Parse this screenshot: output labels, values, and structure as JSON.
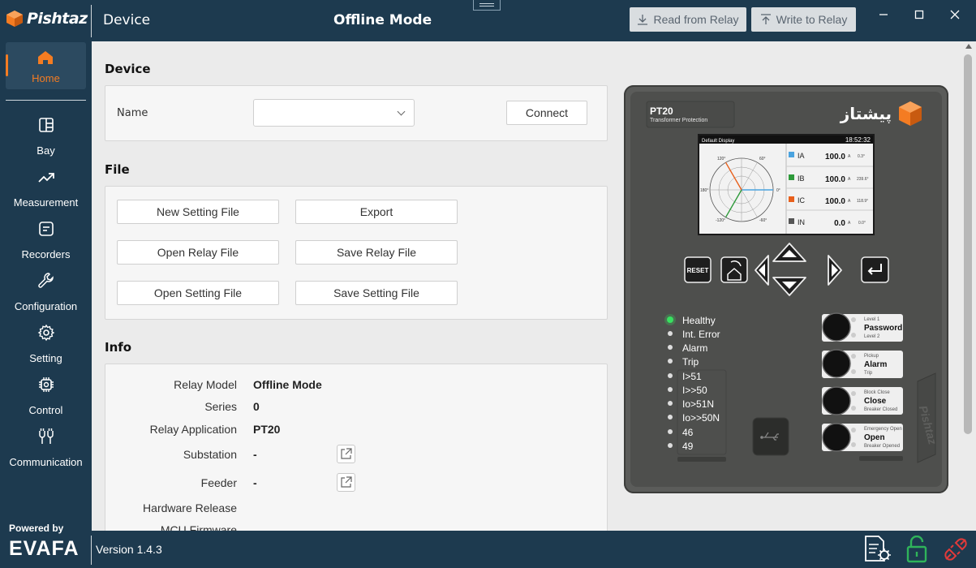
{
  "brand": {
    "name": "Pishtaz",
    "accent": "#f47c22",
    "nav_bg": "#1d3a4f"
  },
  "header": {
    "section": "Device",
    "mode": "Offline Mode",
    "read_btn": "Read from Relay",
    "write_btn": "Write to Relay"
  },
  "sidebar": {
    "items": [
      {
        "label": "Home",
        "icon": "home-icon"
      },
      {
        "label": "Bay",
        "icon": "bay-icon"
      },
      {
        "label": "Measurement",
        "icon": "trend-icon"
      },
      {
        "label": "Recorders",
        "icon": "recorder-icon"
      },
      {
        "label": "Configuration",
        "icon": "wrench-icon"
      },
      {
        "label": "Setting",
        "icon": "gear-icon"
      },
      {
        "label": "Control",
        "icon": "chip-icon"
      },
      {
        "label": "Communication",
        "icon": "plug-icon"
      }
    ]
  },
  "device": {
    "title": "Device",
    "name_label": "Name",
    "name_value": "",
    "connect_btn": "Connect"
  },
  "file": {
    "title": "File",
    "buttons": [
      "New Setting File",
      "Export",
      "Open Relay File",
      "Save Relay File",
      "Open Setting File",
      "Save Setting File"
    ]
  },
  "info": {
    "title": "Info",
    "rows": [
      {
        "label": "Relay Model",
        "value": "Offline Mode"
      },
      {
        "label": "Series",
        "value": "0"
      },
      {
        "label": "Relay Application",
        "value": "PT20"
      },
      {
        "label": "Substation",
        "value": "-"
      },
      {
        "label": "Feeder",
        "value": "-"
      },
      {
        "label": "Hardware Release",
        "value": ""
      },
      {
        "label": "MCU Firmware",
        "value": ""
      }
    ]
  },
  "relay": {
    "model": "PT20",
    "subtitle": "Transformer Protection",
    "brand_fa": "پیشتاز",
    "screen_title": "Default Display",
    "screen_time": "18:52:32",
    "phases": [
      {
        "name": "IA",
        "value": "100.0",
        "unit": "A",
        "angle": "0.3°",
        "color": "#4aa3df"
      },
      {
        "name": "IB",
        "value": "100.0",
        "unit": "A",
        "angle": "239.6°",
        "color": "#2e9a3a"
      },
      {
        "name": "IC",
        "value": "100.0",
        "unit": "A",
        "angle": "118.9°",
        "color": "#e8601c"
      },
      {
        "name": "IN",
        "value": "0.0",
        "unit": "A",
        "angle": "0.0°",
        "color": "#555555"
      }
    ],
    "angle_labels": [
      "120°",
      "60°",
      "180°",
      "0°",
      "-120°",
      "-60°"
    ],
    "reset_label": "RESET",
    "leds": [
      "Healthy",
      "Int. Error",
      "Alarm",
      "Trip",
      "I>51",
      "I>>50",
      "Io>51N",
      "Io>>50N",
      "46",
      "49"
    ],
    "keys": [
      {
        "top": "Level 1",
        "main": "Password",
        "bottom": "Level 2"
      },
      {
        "top": "Pickup",
        "main": "Alarm",
        "bottom": "Trip"
      },
      {
        "top": "Block Close",
        "main": "Close",
        "bottom": "Breaker Closed"
      },
      {
        "top": "Emergency Open",
        "main": "Open",
        "bottom": "Breaker Opened"
      }
    ],
    "side_brand": "Pishtaz"
  },
  "footer": {
    "powered_by": "Powered by",
    "company": "EVAFA",
    "version": "Version 1.4.3"
  }
}
